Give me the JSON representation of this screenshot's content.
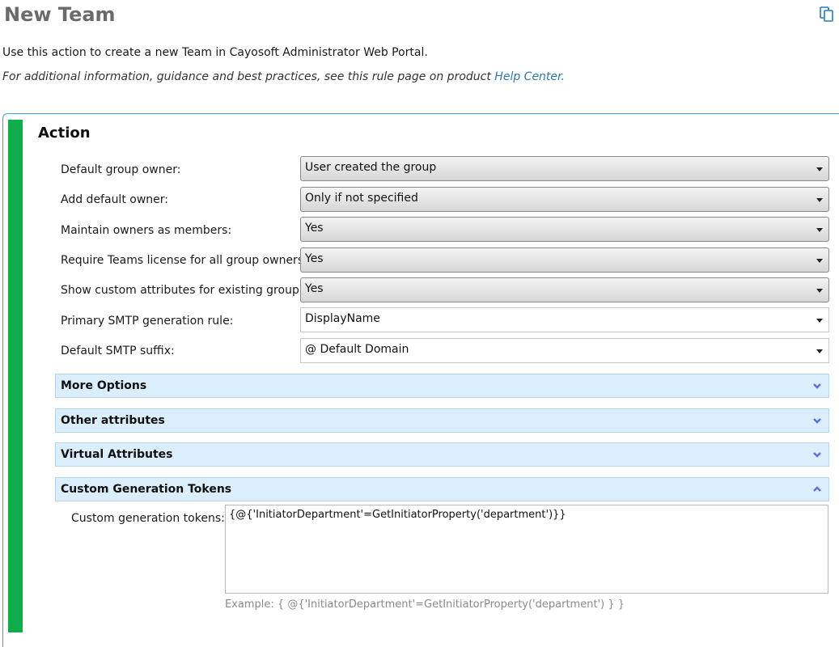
{
  "header": {
    "title": "New Team",
    "description": "Use this action to create a new Team in Cayosoft Administrator Web Portal.",
    "note_prefix": "For additional information, guidance and best practices, see this rule page on product ",
    "help_link": "Help Center."
  },
  "icons": {
    "copy": "copy-icon",
    "accent": "#2a7ab8",
    "green_bar": "#0fae4b"
  },
  "action": {
    "section_title": "Action",
    "fields": [
      {
        "label": "Default group owner:",
        "value": "User created the group"
      },
      {
        "label": "Add default owner:",
        "value": "Only if not specified"
      },
      {
        "label": "Maintain owners as members:",
        "value": "Yes"
      },
      {
        "label": "Require Teams license for all group owners:",
        "value": "Yes"
      },
      {
        "label": "Show custom attributes for existing group:",
        "value": "Yes"
      },
      {
        "label": "Primary SMTP generation rule:",
        "value": "DisplayName"
      },
      {
        "label": "Default SMTP suffix:",
        "value": "@ Default Domain"
      }
    ],
    "accordions": [
      {
        "label": "More Options",
        "state": "collapsed"
      },
      {
        "label": "Other attributes",
        "state": "collapsed"
      },
      {
        "label": "Virtual Attributes",
        "state": "collapsed"
      },
      {
        "label": "Custom Generation Tokens",
        "state": "expanded"
      }
    ],
    "tokens": {
      "label": "Custom generation tokens:",
      "value": "{@{'InitiatorDepartment'=GetInitiatorProperty('department')}}",
      "example": "Example: { @{'InitiatorDepartment'=GetInitiatorProperty('department') } }"
    }
  }
}
